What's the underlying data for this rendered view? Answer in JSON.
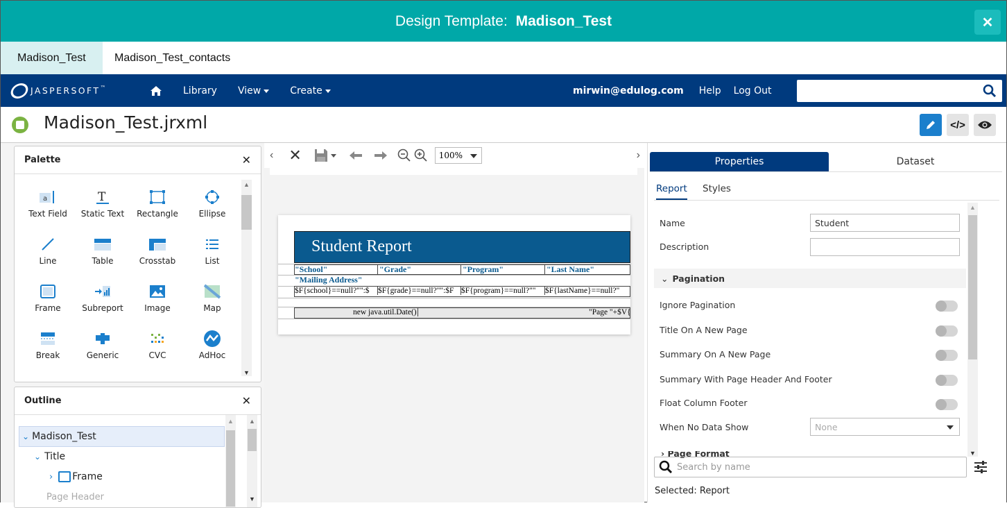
{
  "dialog": {
    "title_prefix": "Design Template: ",
    "title_name": "Madison_Test",
    "close_label": "✕"
  },
  "doc_tabs": [
    "Madison_Test",
    "Madison_Test_contacts"
  ],
  "nav": {
    "logo_text": "JASPERSOFT",
    "library": "Library",
    "view": "View",
    "create": "Create",
    "user": "mirwin@edulog.com",
    "help": "Help",
    "logout": "Log Out",
    "search_value": ""
  },
  "file": {
    "name": "Madison_Test.jrxml"
  },
  "palette": {
    "title": "Palette",
    "items": [
      "Text Field",
      "Static Text",
      "Rectangle",
      "Ellipse",
      "Line",
      "Table",
      "Crosstab",
      "List",
      "Frame",
      "Subreport",
      "Image",
      "Map",
      "Break",
      "Generic",
      "CVC",
      "AdHoc"
    ]
  },
  "outline": {
    "title": "Outline",
    "root": "Madison_Test",
    "title_band": "Title",
    "frame": "Frame",
    "page_header": "Page Header"
  },
  "editor": {
    "zoom": "100%"
  },
  "report": {
    "title": "Student Report",
    "headers": [
      "\"School\"",
      "\"Grade\"",
      "\"Program\"",
      "\"Last Name\""
    ],
    "mailing": "\"Mailing Address\"",
    "detail": [
      "$F{school}==null?\"\":$",
      "$F{grade}==null?\"\":$F",
      "$F{program}==null?\"\"",
      "$F{lastName}==null?\""
    ],
    "footer_left": "new java.util.Date()",
    "footer_right": "\"Page \"+$V{"
  },
  "properties": {
    "tab_properties": "Properties",
    "tab_dataset": "Dataset",
    "sub_report": "Report",
    "sub_styles": "Styles",
    "name_label": "Name",
    "name_value": "Student",
    "description_label": "Description",
    "description_value": "",
    "pagination_section": "Pagination",
    "toggles": [
      "Ignore Pagination",
      "Title On A New Page",
      "Summary On A New Page",
      "Summary With Page Header And Footer",
      "Float Column Footer"
    ],
    "when_no_data_label": "When No Data Show",
    "when_no_data_value": "None",
    "page_format_section": "Page Format",
    "search_placeholder": "Search by name",
    "selected": "Selected: Report"
  },
  "colors": {
    "titlebar": "#00a8a8",
    "nav": "#003a7e",
    "accent": "#1b7fcc",
    "report_band": "#0a5a8f"
  }
}
